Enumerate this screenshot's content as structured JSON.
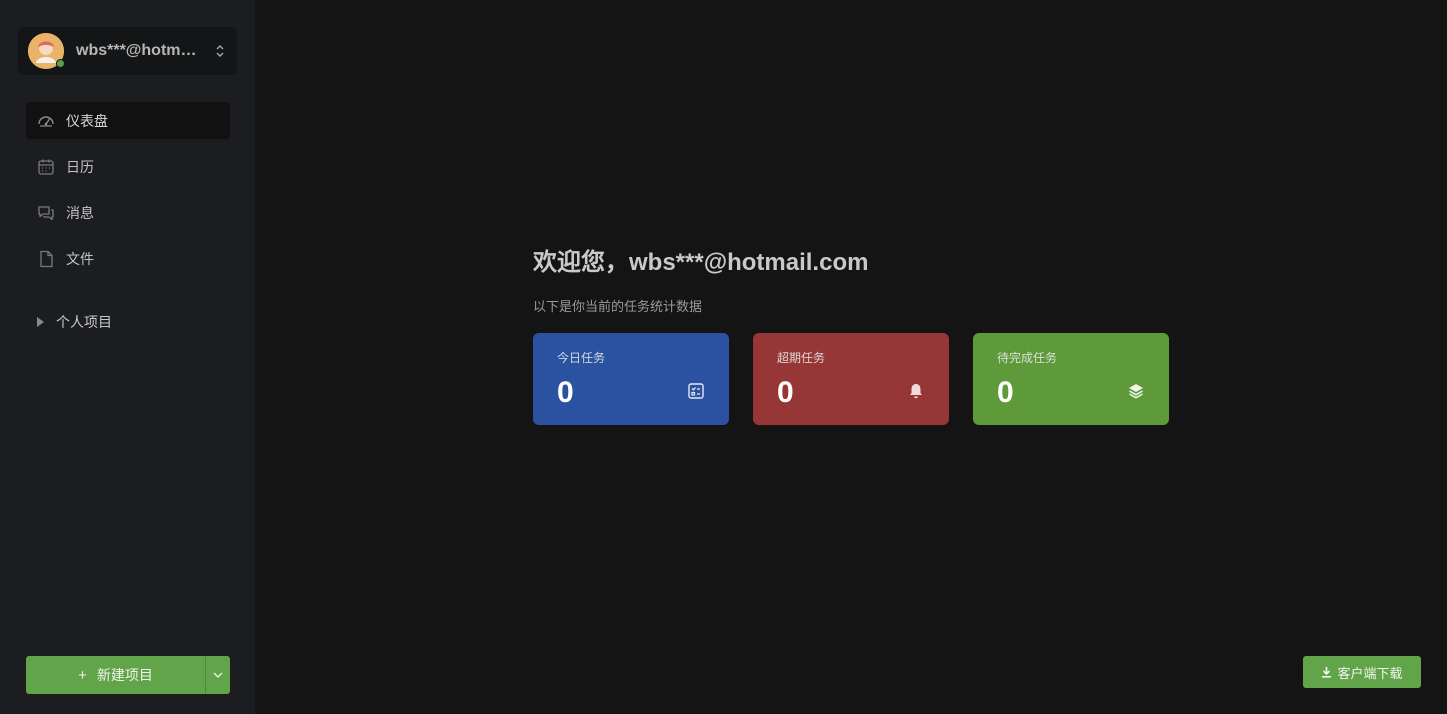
{
  "user": {
    "name": "wbs***@hotm…",
    "status": "online",
    "avatar_icon": "user-avatar-icon"
  },
  "nav": {
    "items": [
      {
        "label": "仪表盘",
        "icon": "dashboard-icon",
        "active": true
      },
      {
        "label": "日历",
        "icon": "calendar-icon",
        "active": false
      },
      {
        "label": "消息",
        "icon": "message-icon",
        "active": false
      },
      {
        "label": "文件",
        "icon": "file-icon",
        "active": false
      }
    ]
  },
  "projects": {
    "group_label": "个人项目"
  },
  "actions": {
    "new_project_label": "新建项目",
    "download_label": "客户端下载"
  },
  "main": {
    "welcome": "欢迎您，wbs***@hotmail.com",
    "subtitle": "以下是你当前的任务统计数据",
    "cards": [
      {
        "label": "今日任务",
        "value": "0",
        "color": "#2a52a0",
        "icon": "checklist-icon"
      },
      {
        "label": "超期任务",
        "value": "0",
        "color": "#973636",
        "icon": "bell-icon"
      },
      {
        "label": "待完成任务",
        "value": "0",
        "color": "#5e9a3a",
        "icon": "layers-icon"
      }
    ]
  },
  "colors": {
    "accent_green": "#62a44a",
    "sidebar_bg": "#1c1d20",
    "main_bg": "#141414"
  }
}
